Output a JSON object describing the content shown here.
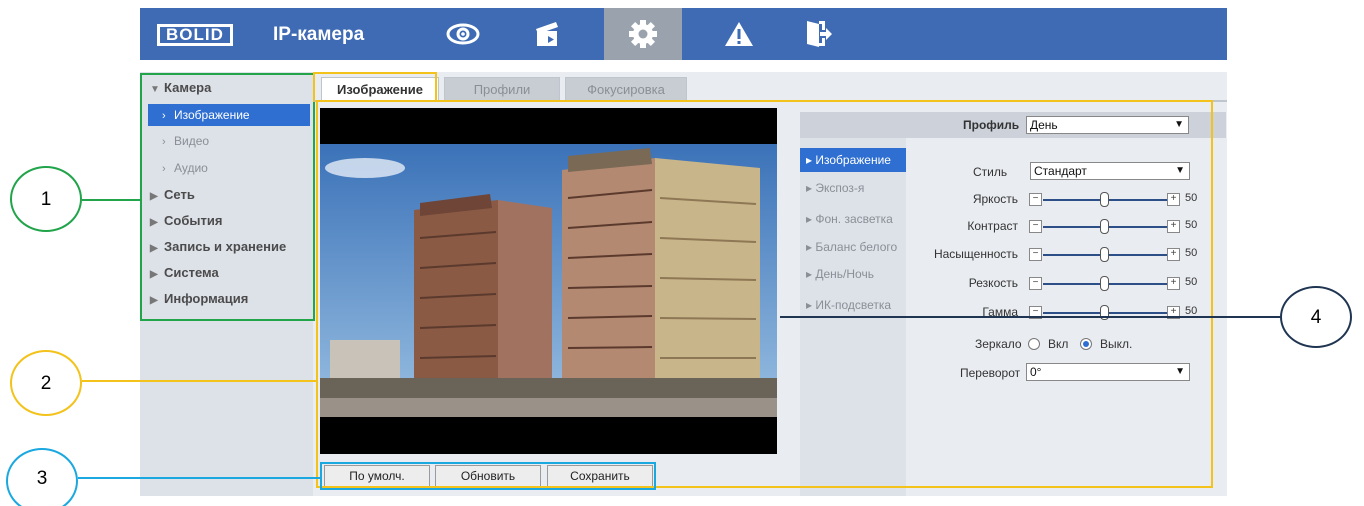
{
  "header": {
    "logo": "BOLID",
    "title": "IP-камера",
    "nav": [
      {
        "icon": "eye-icon",
        "active": false
      },
      {
        "icon": "clapperboard-icon",
        "active": false
      },
      {
        "icon": "gear-icon",
        "active": true
      },
      {
        "icon": "warning-icon",
        "active": false
      },
      {
        "icon": "exit-icon",
        "active": false
      }
    ]
  },
  "sidebar": {
    "camera_label": "Камера",
    "items": [
      {
        "label": "Изображение",
        "active": true
      },
      {
        "label": "Видео",
        "active": false
      },
      {
        "label": "Аудио",
        "active": false
      }
    ],
    "sections": [
      "Сеть",
      "События",
      "Запись и хранение",
      "Система",
      "Информация"
    ]
  },
  "tabs": [
    {
      "label": "Изображение",
      "active": true
    },
    {
      "label": "Профили",
      "active": false
    },
    {
      "label": "Фокусировка",
      "active": false
    }
  ],
  "profile": {
    "label": "Профиль",
    "value": "День"
  },
  "submenu": [
    "Изображение",
    "Экспоз-я",
    "Фон. засветка",
    "Баланс белого",
    "День/Ночь",
    "ИК-подсветка"
  ],
  "settings": {
    "style": {
      "label": "Стиль",
      "value": "Стандарт"
    },
    "sliders": [
      {
        "label": "Яркость",
        "value": 50
      },
      {
        "label": "Контраст",
        "value": 50
      },
      {
        "label": "Насыщенность",
        "value": 50
      },
      {
        "label": "Резкость",
        "value": 50
      },
      {
        "label": "Гамма",
        "value": 50
      }
    ],
    "mirror": {
      "label": "Зеркало",
      "on_label": "Вкл",
      "off_label": "Выкл.",
      "selected": "off"
    },
    "flip": {
      "label": "Переворот",
      "value": "0°"
    }
  },
  "buttons": {
    "default": "По умолч.",
    "refresh": "Обновить",
    "save": "Сохранить"
  },
  "callouts": [
    "1",
    "2",
    "3",
    "4"
  ],
  "colors": {
    "header": "#3e6bb4",
    "active": "#2f6fd1",
    "green": "#21a44a",
    "yellow": "#f3c21b",
    "cyan": "#1ba8e0",
    "navy": "#1f3552"
  }
}
